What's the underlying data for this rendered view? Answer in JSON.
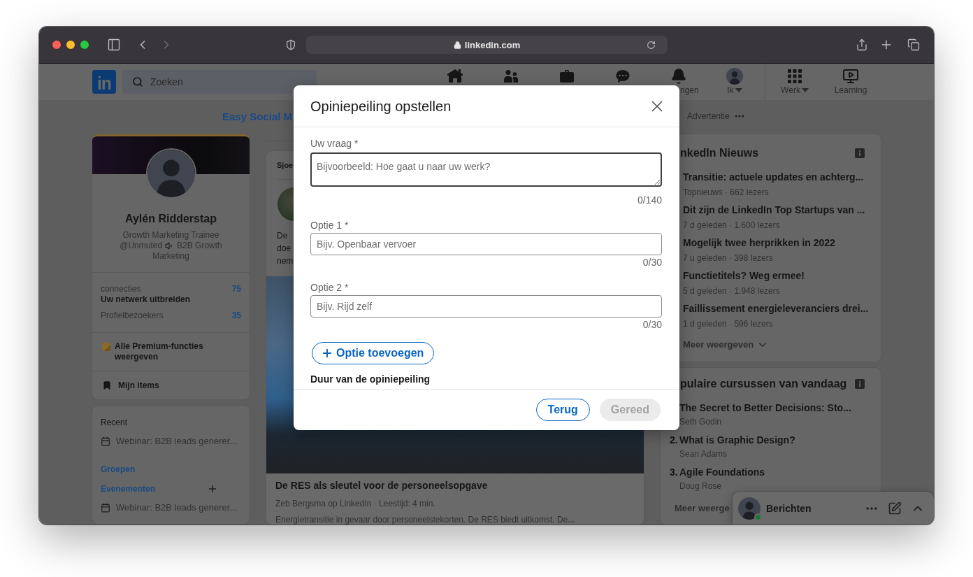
{
  "browser": {
    "navigation": [
      {
        "kind": "back",
        "disabled": false
      },
      {
        "kind": "forward",
        "disabled": true
      }
    ],
    "url": "linkedin.com"
  },
  "nav": {
    "logo": "in",
    "search": {
      "placeholder": "Zoeken"
    },
    "items": [
      {
        "kind": "home"
      },
      {
        "kind": "network"
      },
      {
        "kind": "jobs"
      },
      {
        "kind": "messaging"
      },
      {
        "kind": "notifications",
        "label": "ngen",
        "clipped": true,
        "menu": false
      },
      {
        "kind": "me",
        "label": "Ik",
        "clipped": false,
        "menu": true
      }
    ],
    "apps": [
      {
        "kind": "work",
        "label": "Werk",
        "clipped": false,
        "menu": true
      },
      {
        "kind": "learning",
        "label": "Learning",
        "clipped": false,
        "menu": false
      }
    ]
  },
  "ad": {
    "text": "Easy Social M",
    "label": "Advertentie"
  },
  "profile": {
    "premium": true,
    "name": "Aylén Ridderstap",
    "headline": [
      {
        "kind": "text",
        "text": "Growth Marketing Trainee"
      },
      {
        "kind": "text",
        "text": "@Unmuted"
      },
      {
        "kind": "speaker"
      },
      {
        "kind": "text",
        "text": "B2B Growth"
      },
      {
        "kind": "text",
        "text": "Marketing"
      }
    ],
    "stats": [
      {
        "label": "connecties",
        "value": "75",
        "action": "Uw netwerk uitbreiden"
      },
      {
        "label": "Profielbezoekers",
        "value": "35"
      }
    ],
    "premium_link": "Alle Premium-functies weergeven",
    "saved": "Mijn items"
  },
  "shortcuts": {
    "recent_title": "Recent",
    "recent": [
      "Webinar: B2B leads generer..."
    ],
    "groups": "Groepen",
    "events": "Evenementen",
    "event_items": [
      "Webinar: B2B leads generer..."
    ]
  },
  "feed": {
    "header": "Sjoe",
    "post_lines": [
      "De",
      "doe",
      "nem"
    ],
    "article": {
      "title": "De RES als sleutel voor de personeelsopgave",
      "meta": "Zeb Bergsma op LinkedIn · Leestijd: 4 min.",
      "description": "Energietransitie in gevaar door personeelstekorten. De RES biedt uitkomst. De..."
    }
  },
  "news": {
    "title": "nkedIn Nieuws",
    "items": [
      {
        "title": "Transitie: actuele updates en achterg...",
        "meta": "Topnieuws · 662 lezers"
      },
      {
        "title": "Dit zijn de LinkedIn Top Startups van ...",
        "meta": "7 d geleden · 1.600 lezers"
      },
      {
        "title": "Mogelijk twee herprikken in 2022",
        "meta": "7 u geleden · 398 lezers"
      },
      {
        "title": "Functietitels? Weg ermee!",
        "meta": "5 d geleden · 1.948 lezers"
      },
      {
        "title": "Faillissement energieleveranciers drei...",
        "meta": "1 d geleden · 596 lezers"
      }
    ],
    "more": "Meer weergeven"
  },
  "courses": {
    "title": "pulaire cursussen van vandaag",
    "items": [
      {
        "title": "The Secret to Better Decisions: Sto...",
        "author": "Seth Godin"
      },
      {
        "number": "2.",
        "title": "What is Graphic Design?",
        "author": "Sean Adams"
      },
      {
        "number": "3.",
        "title": "Agile Foundations",
        "author": "Doug Rose"
      }
    ],
    "more": "Meer weerge"
  },
  "messaging": {
    "title": "Berichten",
    "online": true
  },
  "modal": {
    "title": "Opiniepeiling opstellen",
    "fields": [
      {
        "kind": "textarea",
        "label": "Uw vraag *",
        "placeholder": "Bijvoorbeeld: Hoe gaat u naar uw werk?",
        "counter": "0/140",
        "focused": true
      },
      {
        "kind": "input",
        "label": "Optie 1 *",
        "placeholder": "Bijv. Openbaar vervoer",
        "counter": "0/30",
        "focused": false
      },
      {
        "kind": "input",
        "label": "Optie 2 *",
        "placeholder": "Bijv. Rijd zelf",
        "counter": "0/30",
        "focused": false
      }
    ],
    "add_option": "Optie toevoegen",
    "duration_title": "Duur van de opiniepeiling",
    "buttons": [
      {
        "label": "Terug",
        "kind": "secondary",
        "disabled": false
      },
      {
        "label": "Gereed",
        "kind": "primary",
        "disabled": true
      }
    ]
  }
}
